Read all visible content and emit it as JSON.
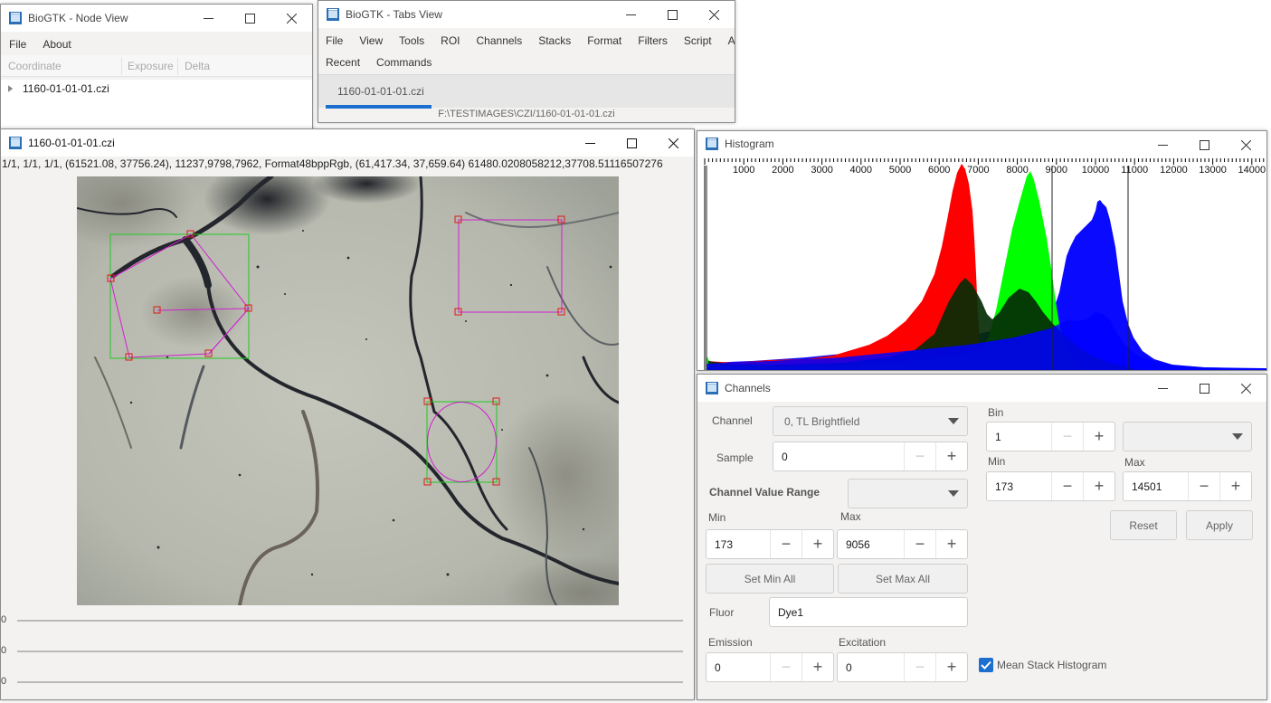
{
  "node_view": {
    "title": "BioGTK - Node View",
    "menu": [
      "File",
      "About"
    ],
    "columns": [
      "Coordinate",
      "Exposure",
      "Delta"
    ],
    "tree_item": "1160-01-01-01.czi"
  },
  "tabs_view": {
    "title": "BioGTK - Tabs View",
    "menu": [
      "File",
      "View",
      "Tools",
      "ROI",
      "Channels",
      "Stacks",
      "Format",
      "Filters",
      "Script",
      "About"
    ],
    "menu2": [
      "Recent",
      "Commands"
    ],
    "tab_label": "1160-01-01-01.czi",
    "path": "F:\\TESTIMAGES\\CZI/1160-01-01-01.czi"
  },
  "image_view": {
    "title": "1160-01-01-01.czi",
    "info": "1/1, 1/1, 1/1, (61521.08, 37756.24), 11237,9798,7962, Format48bppRgb, (61,417.34, 37,659.64) 61480.0208058212,37708.51116507276",
    "slider_labels": [
      "0",
      "0",
      "0"
    ]
  },
  "histogram": {
    "title": "Histogram",
    "ticks": [
      "1000",
      "2000",
      "3000",
      "4000",
      "5000",
      "6000",
      "7000",
      "8000",
      "9000",
      "10000",
      "11000",
      "12000",
      "13000",
      "14000"
    ],
    "colors": {
      "red": "#ff0000",
      "green": "#00ff00",
      "blue": "#0000ff"
    }
  },
  "channels": {
    "title": "Channels",
    "channel_label": "Channel",
    "channel_value": "0, TL Brightfield",
    "sample_label": "Sample",
    "sample_value": "0",
    "range_label": "Channel Value Range",
    "min_label": "Min",
    "max_label": "Max",
    "min_value": "173",
    "max_value": "9056",
    "set_min_all": "Set Min All",
    "set_max_all": "Set Max All",
    "fluor_label": "Fluor",
    "fluor_value": "Dye1",
    "emission_label": "Emission",
    "emission_value": "0",
    "excitation_label": "Excitation",
    "excitation_value": "0",
    "bin_label": "Bin",
    "bin_value": "1",
    "right_min_label": "Min",
    "right_min_value": "173",
    "right_max_label": "Max",
    "right_max_value": "14501",
    "reset": "Reset",
    "apply": "Apply",
    "mean_stack": "Mean Stack Histogram",
    "mean_stack_checked": true
  }
}
